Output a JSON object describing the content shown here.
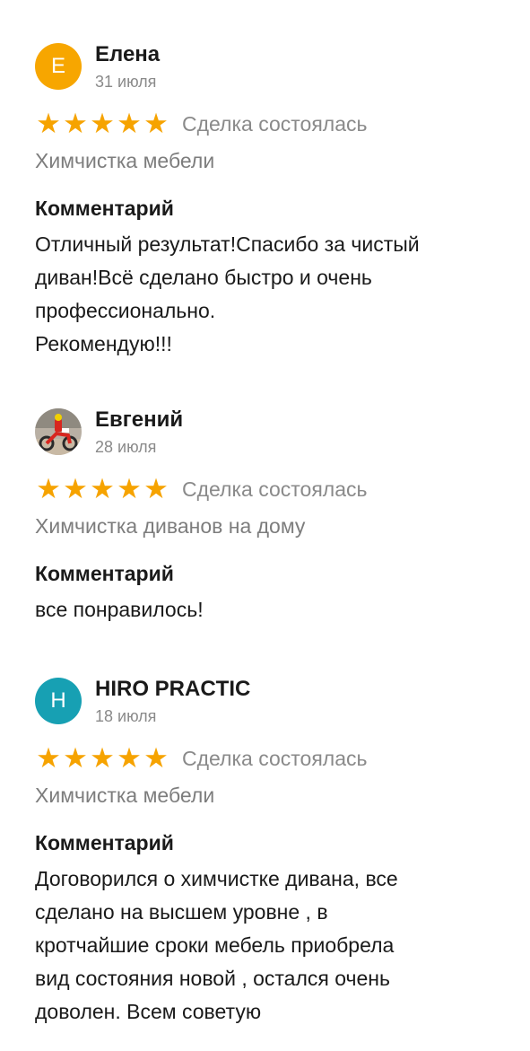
{
  "reviews": [
    {
      "avatar_letter": "E",
      "avatar_color": "#f7a600",
      "name": "Елена",
      "date": "31 июля",
      "rating": 5,
      "deal_status": "Сделка состоялась",
      "service": "Химчистка мебели",
      "comment_label": "Комментарий",
      "comment": "Отличный результат!Спасибо за чистый\nдиван!Всё сделано быстро и очень\nпрофессионально.\nРекомендую!!!"
    },
    {
      "avatar_icon": "user-photo-icon",
      "name": "Евгений",
      "date": "28 июля",
      "rating": 5,
      "deal_status": "Сделка состоялась",
      "service": "Химчистка диванов на дому",
      "comment_label": "Комментарий",
      "comment": "все понравилось!"
    },
    {
      "avatar_letter": "H",
      "avatar_color": "#17a0b3",
      "name": "HIRO PRACTIC",
      "date": "18 июля",
      "rating": 5,
      "deal_status": "Сделка состоялась",
      "service": "Химчистка мебели",
      "comment_label": "Комментарий",
      "comment": "Договорился о химчистке дивана, все\nсделано на высшем уровне , в\nкротчайшие сроки  мебель приобрела\nвид  состояния новой , остался очень\nдоволен. Всем советую"
    }
  ],
  "colors": {
    "star": "#f6a300",
    "muted_text": "#8a8a8a",
    "text": "#1a1a1a"
  }
}
